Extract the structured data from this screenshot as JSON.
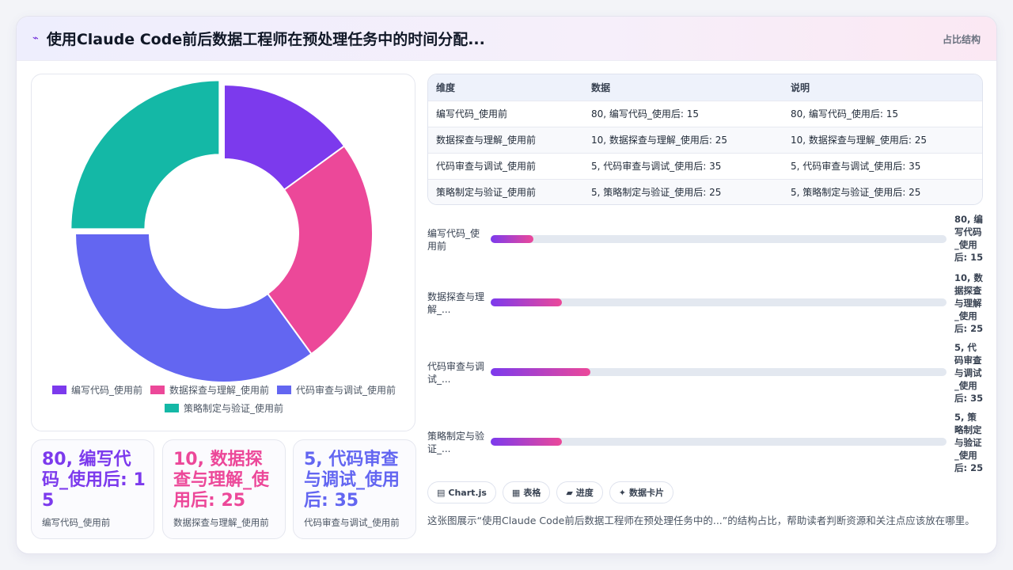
{
  "header": {
    "title": "使用Claude Code前后数据工程师在预处理任务中的时间分配...",
    "tag": "占比结构"
  },
  "colors": {
    "purple": "#7c3aed",
    "pink": "#ec4899",
    "indigo": "#6366f1",
    "teal": "#14b8a6"
  },
  "chart_data": {
    "type": "pie",
    "variant": "doughnut",
    "categories": [
      "编写代码_使用前",
      "数据探查与理解_使用前",
      "代码审查与调试_使用前",
      "策略制定与验证_使用前"
    ],
    "values": [
      15,
      25,
      35,
      25
    ],
    "colors": [
      "#7c3aed",
      "#ec4899",
      "#6366f1",
      "#14b8a6"
    ],
    "legend_position": "bottom"
  },
  "stats": [
    {
      "value": "80, 编写代码_使用后: 15",
      "label": "编写代码_使用前"
    },
    {
      "value": "10, 数据探查与理解_使用后: 25",
      "label": "数据探查与理解_使用前"
    },
    {
      "value": "5, 代码审查与调试_使用后: 35",
      "label": "代码审查与调试_使用前"
    }
  ],
  "table": {
    "headers": [
      "维度",
      "数据",
      "说明"
    ],
    "rows": [
      [
        "编写代码_使用前",
        "80, 编写代码_使用后: 15",
        "80, 编写代码_使用后: 15"
      ],
      [
        "数据探查与理解_使用前",
        "10, 数据探查与理解_使用后: 25",
        "10, 数据探查与理解_使用后: 25"
      ],
      [
        "代码审查与调试_使用前",
        "5, 代码审查与调试_使用后: 35",
        "5, 代码审查与调试_使用后: 35"
      ],
      [
        "策略制定与验证_使用前",
        "5, 策略制定与验证_使用后: 25",
        "5, 策略制定与验证_使用后: 25"
      ]
    ]
  },
  "bars": [
    {
      "label": "编写代码_使用前",
      "value_text": "80, 编写代码_使用后: 15",
      "value": 15
    },
    {
      "label": "数据探查与理解_...",
      "value_text": "10, 数据探查与理解_使用后: 25",
      "value": 25
    },
    {
      "label": "代码审查与调试_...",
      "value_text": "5, 代码审查与调试_使用后: 35",
      "value": 35
    },
    {
      "label": "策略制定与验证_...",
      "value_text": "5, 策略制定与验证_使用后: 25",
      "value": 25
    }
  ],
  "bars_max": 160,
  "chips": [
    {
      "icon": "▤",
      "icon_name": "chart-icon",
      "label": "Chart.js"
    },
    {
      "icon": "▦",
      "icon_name": "table-icon",
      "label": "表格"
    },
    {
      "icon": "▰",
      "icon_name": "progress-icon",
      "label": "进度"
    },
    {
      "icon": "✦",
      "icon_name": "card-icon",
      "label": "数据卡片"
    }
  ],
  "note": "这张图展示“使用Claude Code前后数据工程师在预处理任务中的...”的结构占比，帮助读者判断资源和关注点应该放在哪里。"
}
